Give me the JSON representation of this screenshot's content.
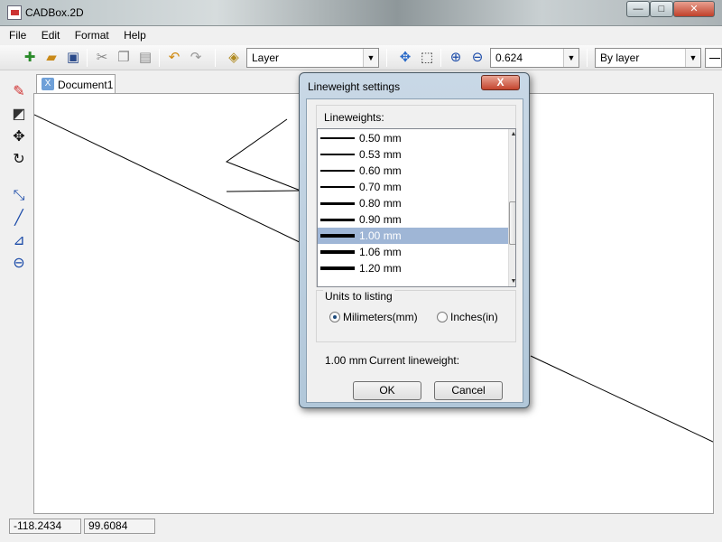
{
  "window": {
    "title": "CADBox.2D",
    "min_label": "—",
    "max_label": "□",
    "close_label": "✕"
  },
  "menu": [
    "File",
    "Edit",
    "Format",
    "Help"
  ],
  "toolbar": {
    "layer_combo": "Layer",
    "zoom_value": "0.624",
    "linetype_combo": "By layer"
  },
  "document": {
    "tab_label": "Document1",
    "tab_close": "X"
  },
  "status": {
    "x": "-118.2434",
    "y": "99.6084"
  },
  "dialog": {
    "title": "Lineweight settings",
    "close_label": "X",
    "lineweights_label": "Lineweights:",
    "items": [
      {
        "label": "0.50 mm",
        "mm": 0.5
      },
      {
        "label": "0.53 mm",
        "mm": 0.53
      },
      {
        "label": "0.60 mm",
        "mm": 0.6
      },
      {
        "label": "0.70 mm",
        "mm": 0.7
      },
      {
        "label": "0.80 mm",
        "mm": 0.8
      },
      {
        "label": "0.90 mm",
        "mm": 0.9
      },
      {
        "label": "1.00 mm",
        "mm": 1.0,
        "selected": true
      },
      {
        "label": "1.06 mm",
        "mm": 1.06
      },
      {
        "label": "1.20 mm",
        "mm": 1.2
      }
    ],
    "units_label": "Units to listing",
    "unit_mm": "Milimeters(mm)",
    "unit_in": "Inches(in)",
    "selected_unit": "mm",
    "current_value": "1.00 mm",
    "current_label": "Current lineweight:",
    "ok_label": "OK",
    "cancel_label": "Cancel"
  }
}
